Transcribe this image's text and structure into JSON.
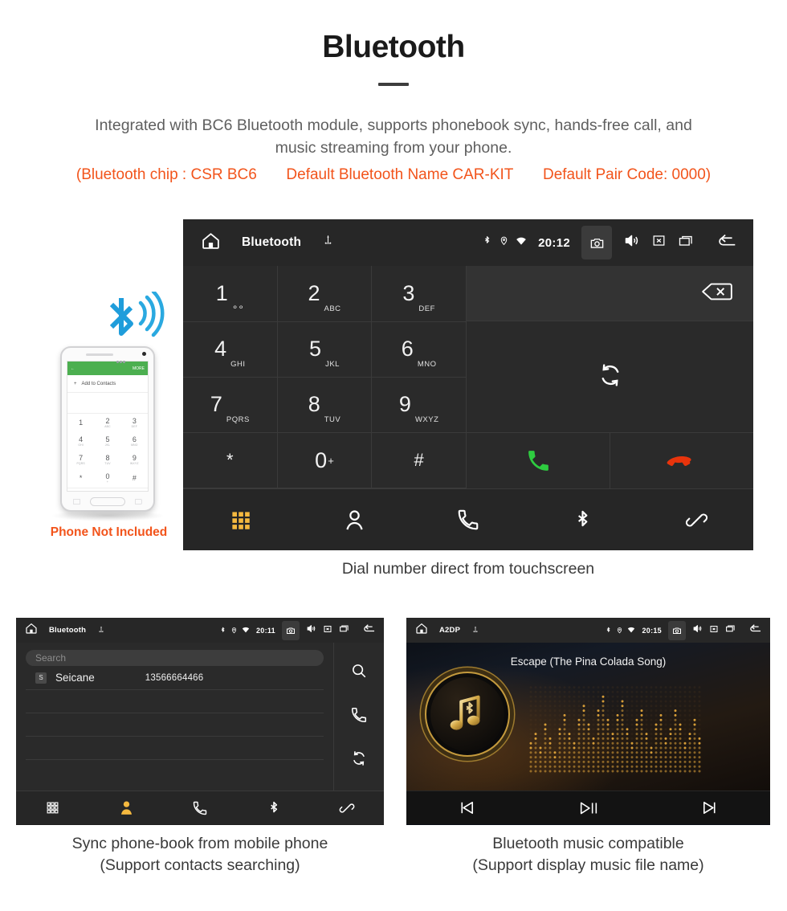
{
  "header": {
    "title": "Bluetooth",
    "intro_line1": "Integrated with BC6 Bluetooth module, supports phonebook sync, hands-free call, and",
    "intro_line2": "music streaming from your phone.",
    "spec_chip": "(Bluetooth chip : CSR BC6",
    "spec_name": "Default Bluetooth Name CAR-KIT",
    "spec_pair": "Default Pair Code: 0000)",
    "accent_color": "#f2541b",
    "text_color": "#5f5f5f"
  },
  "phone_mockup": {
    "note": "Phone Not Included",
    "appbar_more": "MORE",
    "add_contacts": "Add to Contacts",
    "keys": [
      {
        "digit": "1",
        "letters": ""
      },
      {
        "digit": "2",
        "letters": "ABC"
      },
      {
        "digit": "3",
        "letters": "DEF"
      },
      {
        "digit": "4",
        "letters": "GHI"
      },
      {
        "digit": "5",
        "letters": "JKL"
      },
      {
        "digit": "6",
        "letters": "MNO"
      },
      {
        "digit": "7",
        "letters": "PQRS"
      },
      {
        "digit": "8",
        "letters": "TUV"
      },
      {
        "digit": "9",
        "letters": "WXYZ"
      },
      {
        "digit": "*",
        "letters": ""
      },
      {
        "digit": "0",
        "letters": "+"
      },
      {
        "digit": "#",
        "letters": ""
      }
    ]
  },
  "dialer_screen": {
    "statusbar": {
      "title": "Bluetooth",
      "time": "20:12",
      "icons": [
        "home-icon",
        "usb-icon",
        "bluetooth-icon",
        "location-icon",
        "wifi-icon",
        "camera-icon",
        "volume-icon",
        "close-icon",
        "recent-apps-icon",
        "back-icon"
      ]
    },
    "keys": [
      {
        "digit": "1",
        "letters": ""
      },
      {
        "digit": "2",
        "letters": "ABC"
      },
      {
        "digit": "3",
        "letters": "DEF"
      },
      {
        "digit": "4",
        "letters": "GHI"
      },
      {
        "digit": "5",
        "letters": "JKL"
      },
      {
        "digit": "6",
        "letters": "MNO"
      },
      {
        "digit": "7",
        "letters": "PQRS"
      },
      {
        "digit": "8",
        "letters": "TUV"
      },
      {
        "digit": "9",
        "letters": "WXYZ"
      },
      {
        "digit": "*",
        "letters": ""
      },
      {
        "digit": "0",
        "letters": "+"
      },
      {
        "digit": "#",
        "letters": ""
      }
    ],
    "number_value": "",
    "nav": [
      "keypad-icon",
      "contacts-icon",
      "call-log-icon",
      "bluetooth-icon",
      "disconnect-icon"
    ],
    "active_nav": "keypad-icon",
    "active_nav_color": "#f5b93f",
    "call_button_color": "#2ecc40",
    "hangup_button_color": "#e8340c"
  },
  "contacts_screen": {
    "statusbar": {
      "title": "Bluetooth",
      "time": "20:11"
    },
    "search_placeholder": "Search",
    "contacts": [
      {
        "badge": "S",
        "name": "Seicane",
        "number": "13566664466"
      }
    ],
    "side_icons": [
      "search-icon",
      "call-icon",
      "sync-icon"
    ],
    "nav": [
      "keypad-icon",
      "contacts-icon",
      "call-log-icon",
      "bluetooth-icon",
      "disconnect-icon"
    ],
    "active_nav": "contacts-icon",
    "active_nav_color": "#f5b93f"
  },
  "music_screen": {
    "statusbar": {
      "title": "A2DP",
      "time": "20:15"
    },
    "song_title": "Escape (The Pina Colada Song)",
    "controls": [
      "previous-icon",
      "play-pause-icon",
      "next-icon"
    ],
    "accent_color": "#c9952f"
  },
  "captions": {
    "dialer": "Dial number direct from touchscreen",
    "contacts_line1": "Sync phone-book from mobile phone",
    "contacts_line2": "(Support contacts searching)",
    "music_line1": "Bluetooth music compatible",
    "music_line2": "(Support display music file name)"
  }
}
